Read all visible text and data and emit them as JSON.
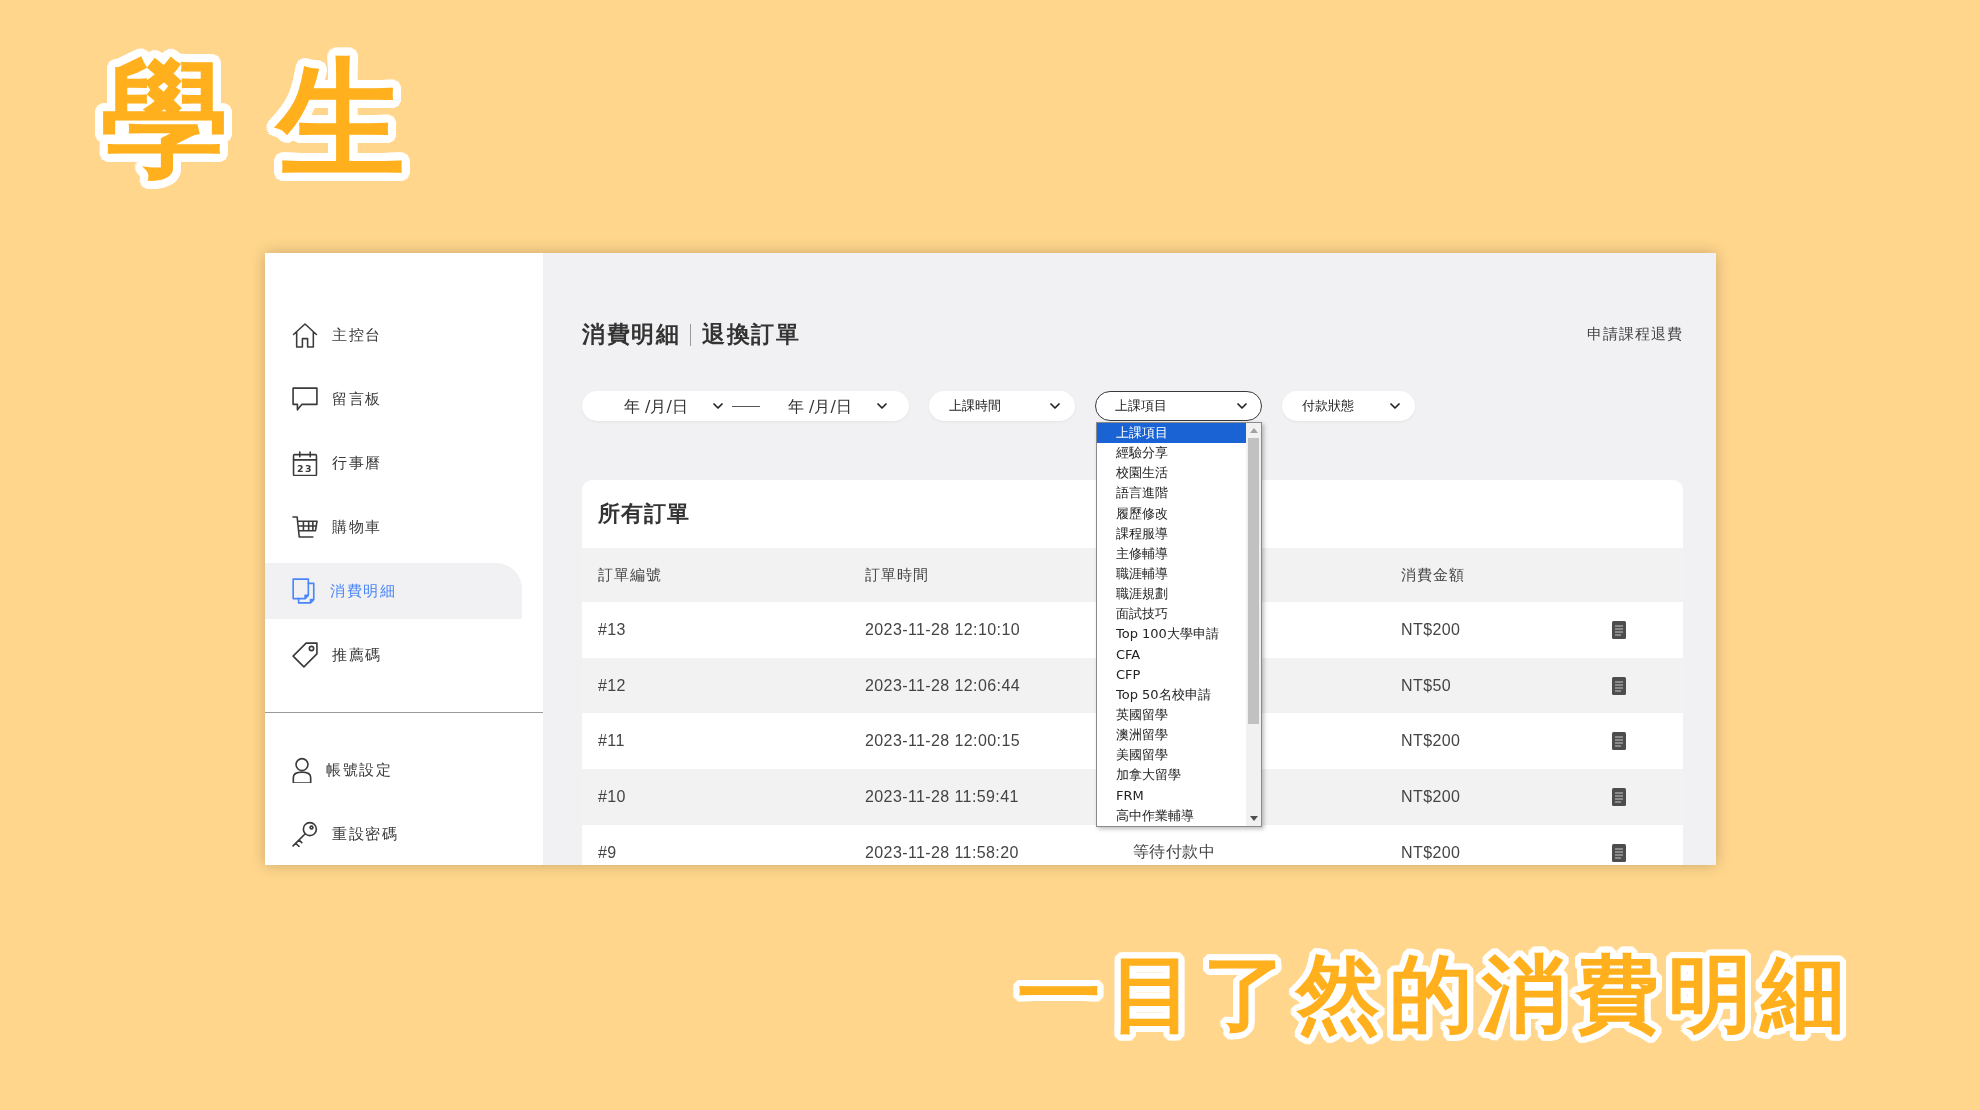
{
  "headline": "學生",
  "app": {
    "sidebar": {
      "items": [
        {
          "kind": "dashboard",
          "label": "主控台",
          "selected": false
        },
        {
          "kind": "messages",
          "label": "留言板",
          "selected": false
        },
        {
          "kind": "calendar",
          "label": "行事曆",
          "icon_text": "23",
          "selected": false
        },
        {
          "kind": "cart",
          "label": "購物車",
          "selected": false
        },
        {
          "kind": "billing",
          "label": "消費明細",
          "selected": true
        },
        {
          "kind": "referral",
          "label": "推薦碼",
          "selected": false
        }
      ],
      "account_items": [
        {
          "kind": "account",
          "label": "帳號設定",
          "selected": false
        },
        {
          "kind": "password",
          "label": "重設密碼",
          "selected": false
        }
      ]
    },
    "header": {
      "title": "消費明細",
      "subtitle": "退換訂單",
      "action": "申請課程退費"
    },
    "filters": {
      "date_range": [
        {
          "placeholder": "年 /月/日"
        },
        {
          "placeholder": "年 /月/日"
        }
      ],
      "selects": [
        {
          "label": "上課時間",
          "open": false
        },
        {
          "label": "上課項目",
          "open": true,
          "options": [
            {
              "label": "上課項目",
              "selected": true
            },
            {
              "label": "經驗分享",
              "selected": false
            },
            {
              "label": "校園生活",
              "selected": false
            },
            {
              "label": "語言進階",
              "selected": false
            },
            {
              "label": "履歷修改",
              "selected": false
            },
            {
              "label": "課程服導",
              "selected": false
            },
            {
              "label": "主修輔導",
              "selected": false
            },
            {
              "label": "職涯輔導",
              "selected": false
            },
            {
              "label": "職涯規劃",
              "selected": false
            },
            {
              "label": "面試技巧",
              "selected": false
            },
            {
              "label": "Top 100大學申請",
              "selected": false
            },
            {
              "label": "CFA",
              "selected": false
            },
            {
              "label": "CFP",
              "selected": false
            },
            {
              "label": "Top 50名校申請",
              "selected": false
            },
            {
              "label": "英國留學",
              "selected": false
            },
            {
              "label": "澳洲留學",
              "selected": false
            },
            {
              "label": "美國留學",
              "selected": false
            },
            {
              "label": "加拿大留學",
              "selected": false
            },
            {
              "label": "FRM",
              "selected": false
            },
            {
              "label": "高中作業輔導",
              "selected": false
            }
          ]
        },
        {
          "label": "付款狀態",
          "open": false
        }
      ]
    },
    "orders": {
      "title": "所有訂單",
      "columns": {
        "number": "訂單編號",
        "time": "訂單時間",
        "amount": "消費金額"
      },
      "rows": [
        {
          "number": "#13",
          "time": "2023-11-28 12:10:10",
          "amount": "NT$200"
        },
        {
          "number": "#12",
          "time": "2023-11-28 12:06:44",
          "amount": "NT$50"
        },
        {
          "number": "#11",
          "time": "2023-11-28 12:00:15",
          "amount": "NT$200"
        },
        {
          "number": "#10",
          "time": "2023-11-28 11:59:41",
          "amount": "NT$200"
        },
        {
          "number": "#9",
          "time": "2023-11-28 11:58:20",
          "column_3": "等待付款中",
          "amount": "NT$200"
        }
      ]
    }
  },
  "caption": "一目了然的消費明細"
}
